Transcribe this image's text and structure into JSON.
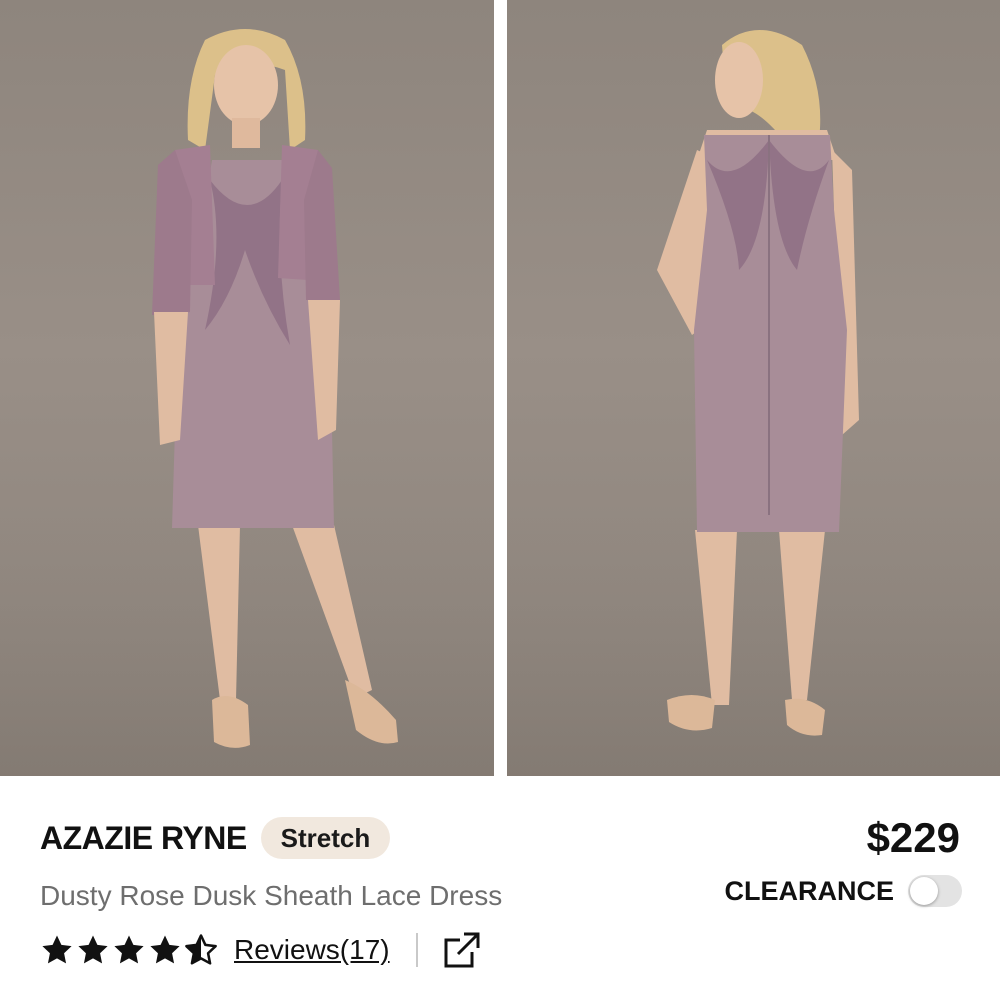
{
  "gallery": {
    "images": [
      {
        "alt": "front view",
        "icon": "dress-front-photo"
      },
      {
        "alt": "back view",
        "icon": "dress-back-photo"
      }
    ],
    "colors": {
      "backdrop": "#948a82",
      "dress": "#a88d98",
      "lace": "#8e6f84",
      "skin": "#e0bca2",
      "hair": "#e0c48d",
      "shoes": "#dcb899"
    }
  },
  "product": {
    "brand": "AZAZIE RYNE",
    "tag": "Stretch",
    "name": "Dusty Rose Dusk Sheath Lace Dress",
    "price": "$229",
    "clearance_label": "CLEARANCE",
    "clearance_on": false,
    "rating": 4.5,
    "rating_max": 5,
    "reviews_label": "Reviews(17)"
  },
  "icons": {
    "star": "star-icon",
    "half_star": "half-star-icon",
    "share": "share-external-icon"
  },
  "colors": {
    "tag_bg": "#f1e8de",
    "text": "#111111",
    "subtext": "#6e6e6e",
    "toggle_off": "#e3e3e3"
  }
}
